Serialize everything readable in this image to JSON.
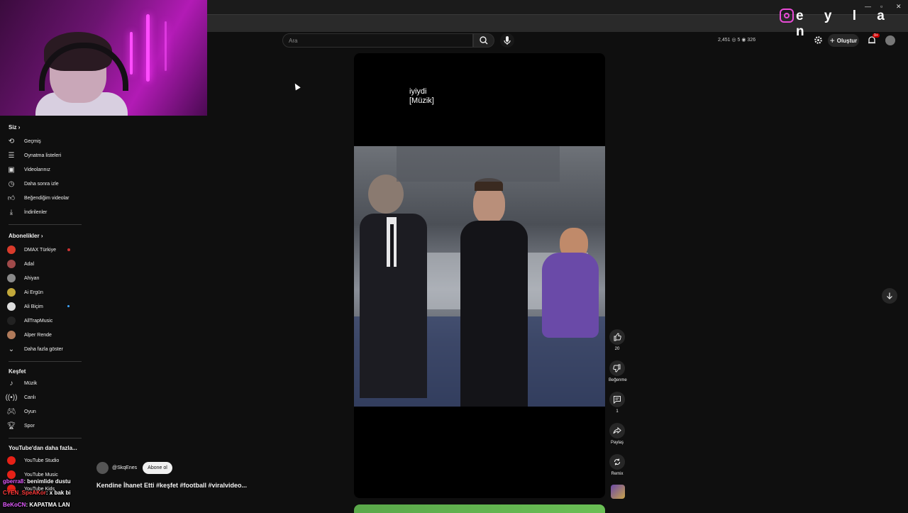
{
  "overlay": {
    "instagram_handle": "e y l a n",
    "chat": [
      {
        "user": "gberra8",
        "message": ": benimlide dustu"
      },
      {
        "user": "CYEN_SpeAKor",
        "message": ": x bak bi"
      },
      {
        "user": "BeKoCN",
        "message": ": KAPATMA LAN"
      }
    ]
  },
  "header": {
    "search_placeholder": "Ara",
    "stats": "2,451  ◎ 5  ◉ 326",
    "create_label": "Oluştur",
    "notification_count": "9+"
  },
  "sidebar": {
    "you": {
      "title": "Siz",
      "items": [
        {
          "label": "Geçmiş",
          "icon": "history-icon"
        },
        {
          "label": "Oynatma listeleri",
          "icon": "playlist-icon"
        },
        {
          "label": "Videolarınız",
          "icon": "your-videos-icon"
        },
        {
          "label": "Daha sonra izle",
          "icon": "watch-later-icon"
        },
        {
          "label": "Beğendiğim videolar",
          "icon": "liked-icon"
        },
        {
          "label": "İndirilenler",
          "icon": "download-icon"
        }
      ]
    },
    "subscriptions": {
      "title": "Abonelikler",
      "items": [
        {
          "label": "DMAX Türkiye",
          "color": "#d93b2b"
        },
        {
          "label": "Adal",
          "color": "#a04a4a"
        },
        {
          "label": "Ahiyan",
          "color": "#8a8a8a"
        },
        {
          "label": "Ai Ergün",
          "color": "#c2a83a"
        },
        {
          "label": "Ali Biçim",
          "color": "#dddddd"
        },
        {
          "label": "AllTrapMusic",
          "color": "#222222"
        },
        {
          "label": "Alper Rende",
          "color": "#b07a5a"
        }
      ],
      "show_more": "Daha fazla göster"
    },
    "explore": {
      "title": "Keşfet",
      "items": [
        {
          "label": "Müzik",
          "icon": "music-icon"
        },
        {
          "label": "Canlı",
          "icon": "live-icon"
        },
        {
          "label": "Oyun",
          "icon": "gaming-icon"
        },
        {
          "label": "Spor",
          "icon": "trophy-icon"
        }
      ]
    },
    "more_from_youtube": {
      "title": "YouTube'dan daha fazla...",
      "items": [
        {
          "label": "YouTube Studio"
        },
        {
          "label": "YouTube Music"
        },
        {
          "label": "YouTube Kids"
        }
      ]
    }
  },
  "short": {
    "caption_line1": "iyiydi",
    "caption_line2": "[Müzik]",
    "channel": "@SkqEnes",
    "subscribe_label": "Abone ol",
    "title": "Kendine İhanet Etti #keşfet #football #viralvideo...",
    "like_count": "20",
    "dislike_label": "Beğenme",
    "comment_count": "1",
    "share_label": "Paylaş",
    "remix_label": "Remix"
  }
}
